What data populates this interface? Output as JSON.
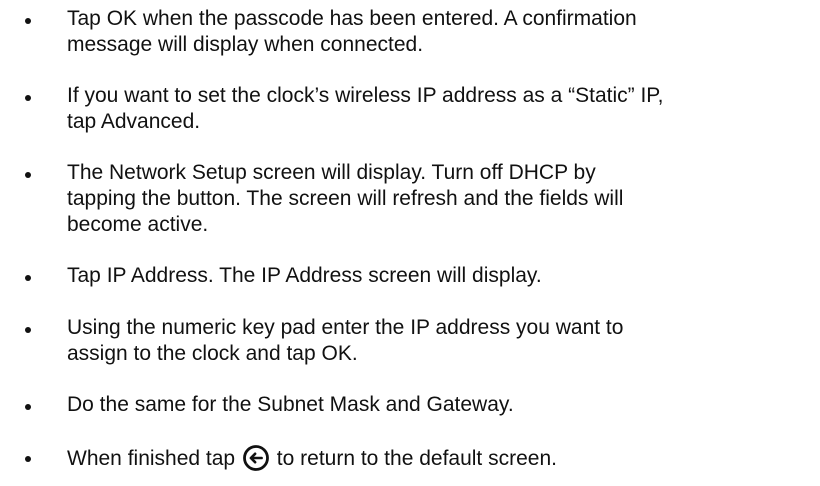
{
  "document": {
    "items": [
      {
        "lines": [
          "Tap OK when the passcode has been entered. A confirmation",
          "message will display when connected."
        ]
      },
      {
        "lines": [
          "If you want to set the clock’s wireless IP address as a “Static” IP,",
          "tap Advanced."
        ]
      },
      {
        "lines": [
          "The Network Setup screen will display. Turn off DHCP by",
          "tapping the button. The screen will refresh and the fields will",
          "become active."
        ]
      },
      {
        "lines": [
          "Tap IP Address. The IP Address screen will display."
        ]
      },
      {
        "lines": [
          "Using the numeric key pad enter the IP address you want to",
          "assign to the clock and tap OK."
        ]
      },
      {
        "lines": [
          "Do the same for the Subnet Mask and Gateway."
        ]
      },
      {
        "before_icon": "When finished tap",
        "icon": "back-arrow-circle-icon",
        "after_icon": "to return to the default screen."
      }
    ]
  }
}
